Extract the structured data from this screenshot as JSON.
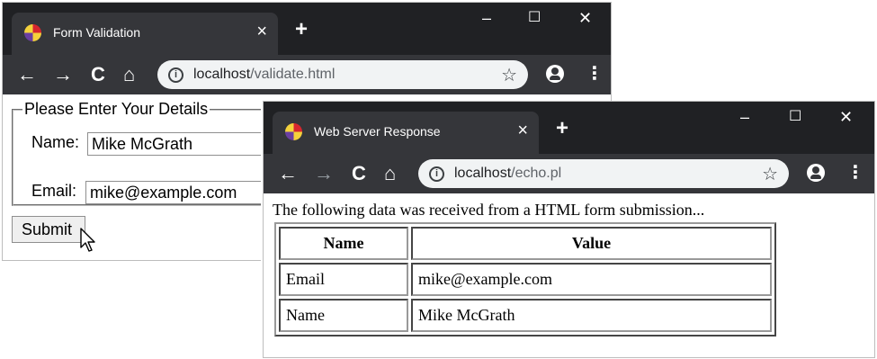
{
  "form_window": {
    "tab_title": "Form Validation",
    "tab_close": "×",
    "new_tab": "+",
    "controls": {
      "minimize": "–",
      "maximize": "☐",
      "close": "✕"
    },
    "nav": {
      "back": "←",
      "forward": "→",
      "reload": "C",
      "home": "⌂"
    },
    "url_host": "localhost",
    "url_path": "/validate.html",
    "info_icon": "i",
    "star": "☆",
    "menu": "⋮",
    "form": {
      "legend": "Please Enter Your Details",
      "name_label": "Name:",
      "name_value": "Mike McGrath",
      "email_label": "Email:",
      "email_value": "mike@example.com",
      "submit_label": "Submit"
    }
  },
  "response_window": {
    "tab_title": "Web Server Response",
    "tab_close": "×",
    "new_tab": "+",
    "controls": {
      "minimize": "–",
      "maximize": "☐",
      "close": "✕"
    },
    "nav": {
      "back": "←",
      "forward": "→",
      "reload": "C",
      "home": "⌂"
    },
    "url_host": "localhost",
    "url_path": "/echo.pl",
    "info_icon": "i",
    "star": "☆",
    "menu": "⋮",
    "message": "The following data was received from a HTML form submission...",
    "table": {
      "headers": [
        "Name",
        "Value"
      ],
      "rows": [
        [
          "Email",
          "mike@example.com"
        ],
        [
          "Name",
          "Mike McGrath"
        ]
      ]
    }
  },
  "colors": {
    "titlebar": "#202124",
    "tab_active": "#35363a",
    "omnibox": "#f1f3f4"
  }
}
